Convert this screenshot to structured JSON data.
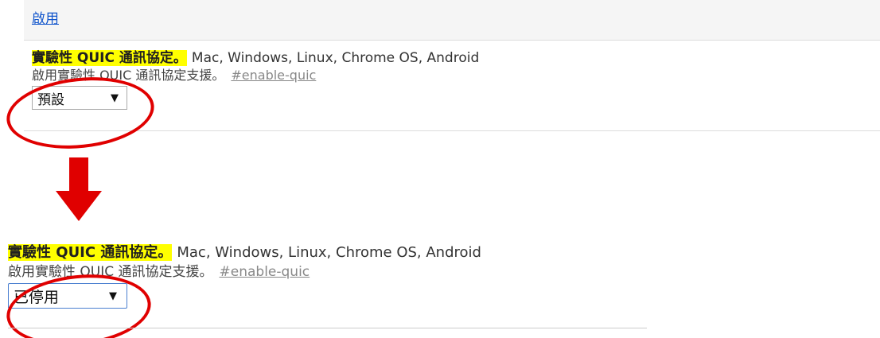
{
  "top_section": {
    "enable_link": "啟用"
  },
  "flags": [
    {
      "name": "實驗性 QUIC 通訊協定。",
      "platforms": "Mac, Windows, Linux, Chrome OS, Android",
      "description": "啟用實驗性 QUIC 通訊協定支援。",
      "anchor": "#enable-quic",
      "selected_value": "預設"
    },
    {
      "name": "實驗性 QUIC 通訊協定。",
      "platforms": "Mac, Windows, Linux, Chrome OS, Android",
      "description": "啟用實驗性 QUIC 通訊協定支援。",
      "anchor": "#enable-quic",
      "selected_value": "已停用"
    }
  ],
  "colors": {
    "highlight": "#ffff00",
    "annotation": "#e00000",
    "link": "#1155cc",
    "select_focus_border": "#4a7fd0"
  },
  "annotations": {
    "arrow_icon": "arrow-down-icon",
    "circle_icon": "red-ellipse-annotation"
  }
}
